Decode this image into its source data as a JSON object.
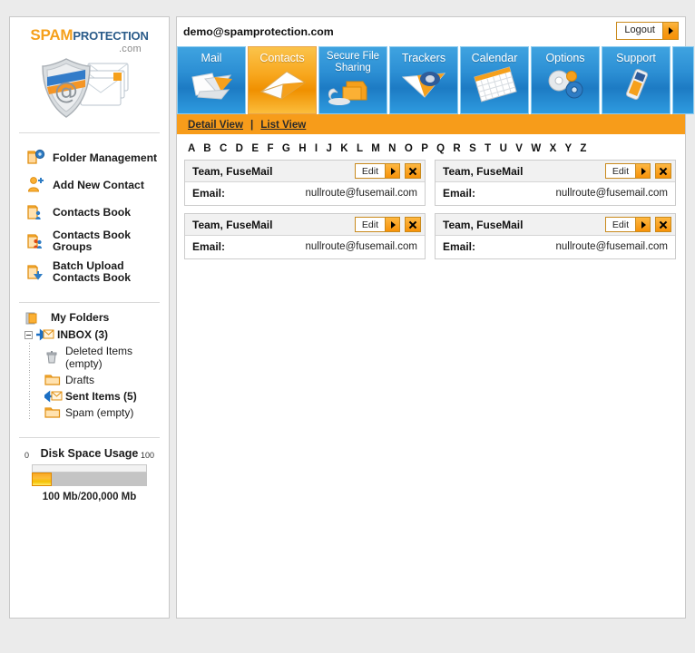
{
  "brand": {
    "name_part1": "SPAM",
    "name_part2_cap": "P",
    "name_part2": "ROTECTION",
    "tld": ".com",
    "logo_icon": "shield-at-envelopes-icon",
    "accent_orange": "#F5A01C",
    "accent_blue": "#2b5c8a"
  },
  "header": {
    "user_email": "demo@spamprotection.com",
    "logout_label": "Logout",
    "logout_arrow_icon": "arrow-right-icon"
  },
  "tabs": [
    {
      "label": "Mail",
      "icon": "mail-envelope-icon",
      "active": false,
      "two_line": false
    },
    {
      "label": "Contacts",
      "icon": "contacts-envelope-icon",
      "active": true,
      "two_line": false
    },
    {
      "label": "Secure File Sharing",
      "icon": "secure-folder-icon",
      "active": false,
      "two_line": true
    },
    {
      "label": "Trackers",
      "icon": "tracker-envelope-icon",
      "active": false,
      "two_line": false
    },
    {
      "label": "Calendar",
      "icon": "calendar-grid-icon",
      "active": false,
      "two_line": false
    },
    {
      "label": "Options",
      "icon": "gears-icon",
      "active": false,
      "two_line": false
    },
    {
      "label": "Support",
      "icon": "mobile-phone-icon",
      "active": false,
      "two_line": false
    }
  ],
  "view_bar": {
    "detail_label": "Detail View",
    "separator": "|",
    "list_label": "List View"
  },
  "alpha_index": "A B C D E F G H I J K L M N O P Q R S T U V W X Y Z",
  "sidebar": {
    "menu": [
      {
        "label": "Folder Management",
        "icon": "folder-gear-icon"
      },
      {
        "label": "Add New Contact",
        "icon": "person-plus-icon"
      },
      {
        "label": "Contacts Book",
        "icon": "folder-person-icon"
      },
      {
        "label": "Contacts Book Groups",
        "icon": "folder-people-icon"
      },
      {
        "label": "Batch Upload Contacts Book",
        "icon": "folder-download-icon"
      }
    ],
    "folders_title": "My Folders",
    "folders_icon": "my-folders-icon",
    "tree": [
      {
        "label": "INBOX (3)",
        "icon": "inbox-arrow-icon",
        "bold": true,
        "level": 1
      },
      {
        "label": "Deleted Items (empty)",
        "icon": "trash-icon",
        "bold": false,
        "level": 2
      },
      {
        "label": "Drafts",
        "icon": "folder-icon",
        "bold": false,
        "level": 2
      },
      {
        "label": "Sent Items (5)",
        "icon": "sent-arrow-icon",
        "bold": true,
        "level": 2
      },
      {
        "label": "Spam (empty)",
        "icon": "folder-icon",
        "bold": false,
        "level": 2
      }
    ],
    "disk": {
      "title": "Disk Space Usage",
      "min_label": "0",
      "max_label": "100",
      "percent": 17,
      "caption_used": "100 Mb",
      "caption_sep": "/",
      "caption_total": "200,000 Mb"
    }
  },
  "contacts": {
    "edit_label": "Edit",
    "edit_arrow_icon": "arrow-right-icon",
    "close_icon": "close-x-icon",
    "email_key": "Email:",
    "cards": [
      {
        "name": "Team, FuseMail",
        "email": "nullroute@fusemail.com"
      },
      {
        "name": "Team, FuseMail",
        "email": "nullroute@fusemail.com"
      },
      {
        "name": "Team, FuseMail",
        "email": "nullroute@fusemail.com"
      },
      {
        "name": "Team, FuseMail",
        "email": "nullroute@fusemail.com"
      }
    ]
  }
}
